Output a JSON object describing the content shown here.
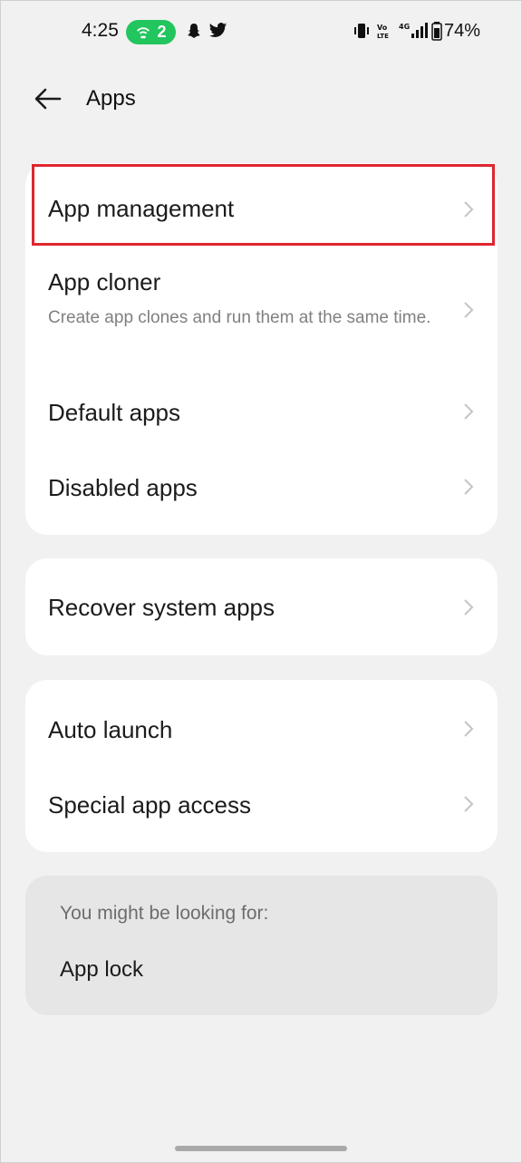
{
  "status_bar": {
    "time": "4:25",
    "hotspot_count": "2",
    "battery": "74%",
    "icons": [
      "hotspot-icon",
      "snapchat-icon",
      "twitter-icon",
      "vibrate-icon",
      "volte-icon",
      "signal-4g-icon",
      "battery-icon"
    ],
    "hotspot_color": "#22c55e"
  },
  "header": {
    "title": "Apps"
  },
  "groups": [
    {
      "items": [
        {
          "label": "App management"
        },
        {
          "label": "App cloner",
          "subtitle": "Create app clones and run them at the same time."
        },
        {
          "label": "Default apps"
        },
        {
          "label": "Disabled apps"
        }
      ]
    },
    {
      "items": [
        {
          "label": "Recover system apps"
        }
      ]
    },
    {
      "items": [
        {
          "label": "Auto launch"
        },
        {
          "label": "Special app access"
        }
      ]
    }
  ],
  "suggestions": {
    "heading": "You might be looking for:",
    "items": [
      "App lock"
    ]
  },
  "highlight_color": "#e0262e"
}
